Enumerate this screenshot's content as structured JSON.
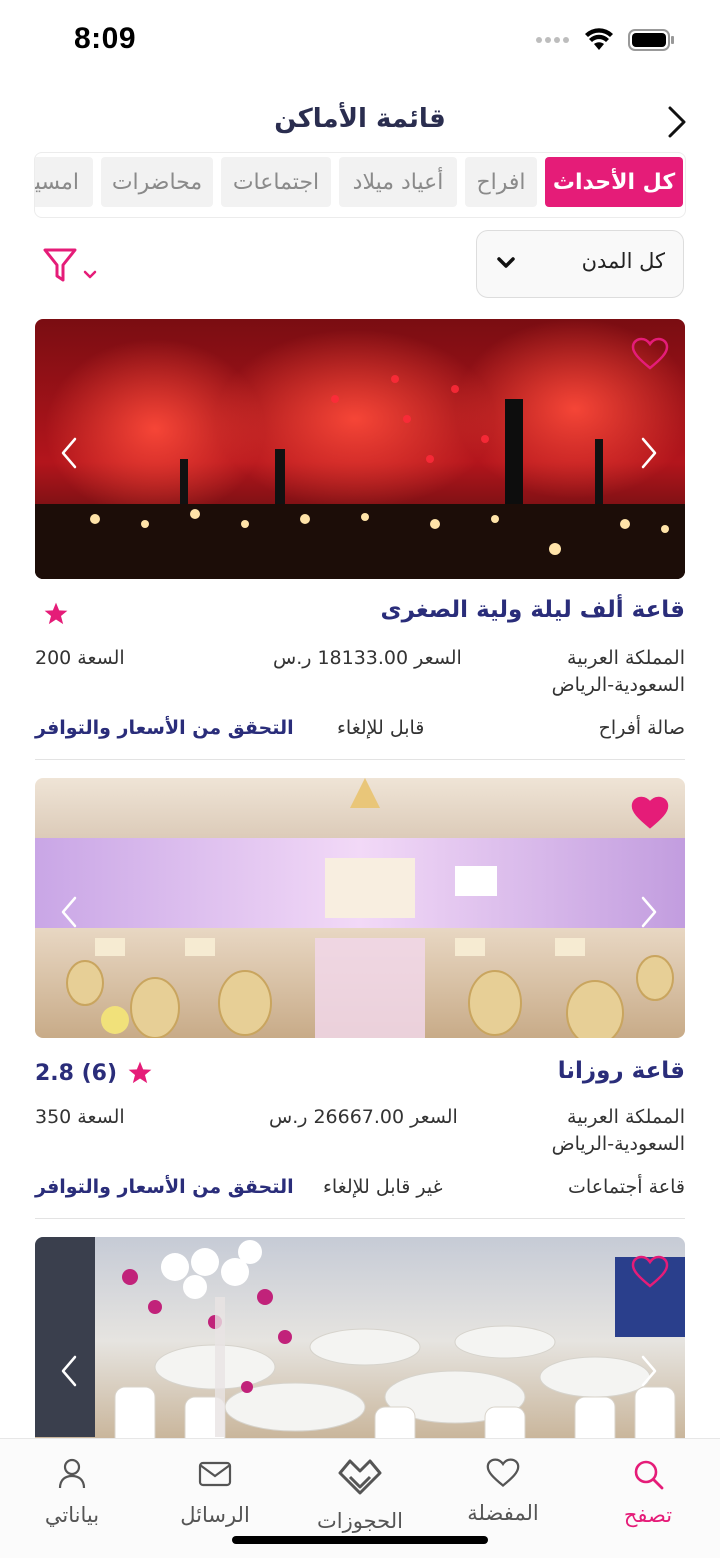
{
  "status": {
    "time": "8:09"
  },
  "header": {
    "title": "قائمة الأماكن"
  },
  "tabs": [
    {
      "label": "كل الأحداث",
      "active": true
    },
    {
      "label": "افراح",
      "active": false
    },
    {
      "label": "أعياد ميلاد",
      "active": false
    },
    {
      "label": "اجتماعات",
      "active": false
    },
    {
      "label": "محاضرات",
      "active": false
    },
    {
      "label": "امسيات",
      "active": false
    }
  ],
  "filters": {
    "city": "كل المدن"
  },
  "venues": [
    {
      "name": "قاعة ألف ليلة ولية الصغرى",
      "rating": "",
      "location_line1": "المملكة العربية",
      "location_line2": "السعودية-الرياض",
      "price": "السعر 18133.00 ر.س",
      "capacity": "السعة 200",
      "type": "صالة أفراح",
      "cancellation": "قابل للإلغاء",
      "check_label": "التحقق من الأسعار والتوافر",
      "favorited": false
    },
    {
      "name": "قاعة روزانا",
      "rating": "2.8 (6)",
      "location_line1": "المملكة العربية",
      "location_line2": "السعودية-الرياض",
      "price": "السعر 26667.00 ر.س",
      "capacity": "السعة 350",
      "type": "قاعة أجتماعات",
      "cancellation": "غير قابل للإلغاء",
      "check_label": "التحقق من الأسعار والتوافر",
      "favorited": true
    },
    {
      "favorited": false
    }
  ],
  "bottom_nav": {
    "browse": "تصفح",
    "favorites": "المفضلة",
    "bookings": "الحجوزات",
    "messages": "الرسائل",
    "profile": "بياناتي"
  },
  "colors": {
    "accent": "#e51c78",
    "navy": "#2a2d7a"
  }
}
